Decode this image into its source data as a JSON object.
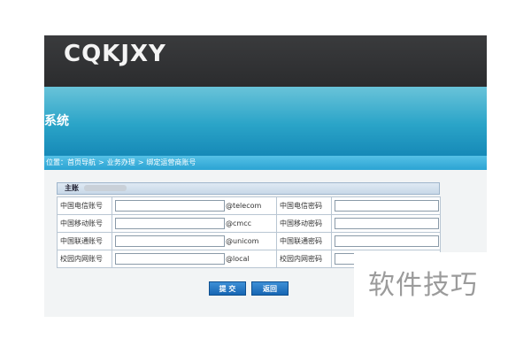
{
  "app": {
    "brand": "CQKJXY",
    "banner_title": "系统"
  },
  "breadcrumb": {
    "prefix": "位置：",
    "items": [
      "首页导航",
      "业务办理",
      "绑定运营商账号"
    ],
    "separator": ">"
  },
  "panel": {
    "title": "主账"
  },
  "accounts": {
    "rows": [
      {
        "account_label": "中国电信账号",
        "suffix": "@telecom",
        "password_label": "中国电信密码"
      },
      {
        "account_label": "中国移动账号",
        "suffix": "@cmcc",
        "password_label": "中国移动密码"
      },
      {
        "account_label": "中国联通账号",
        "suffix": "@unicom",
        "password_label": "中国联通密码"
      },
      {
        "account_label": "校园内网账号",
        "suffix": "@local",
        "password_label": "校园内网密码"
      }
    ]
  },
  "buttons": {
    "submit": "提 交",
    "back": "返回"
  },
  "watermark": "软件技巧",
  "colors": {
    "topbar": "#2b2c2e",
    "banner": "#2aa4c8",
    "breadcrumb": "#2ba3d3",
    "button": "#1766b3"
  }
}
